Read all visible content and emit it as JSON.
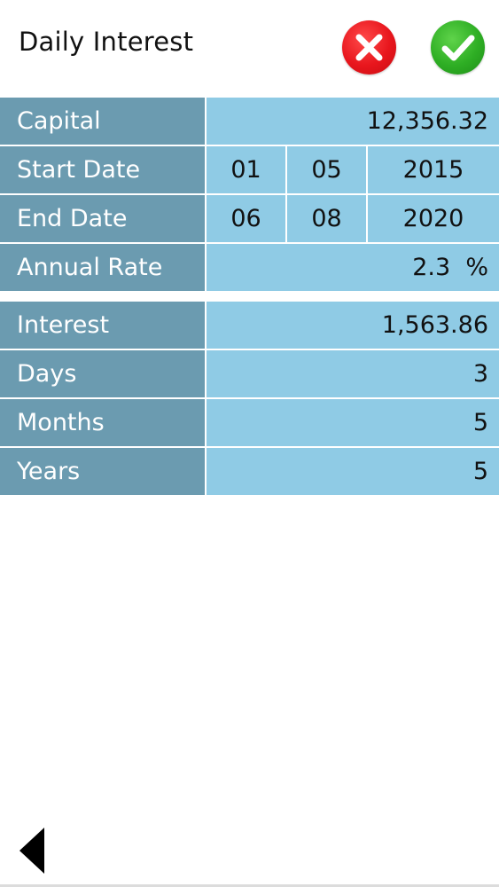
{
  "header": {
    "title": "Daily Interest"
  },
  "inputs": {
    "capital": {
      "label": "Capital",
      "value": "12,356.32"
    },
    "start_date": {
      "label": "Start Date",
      "day": "01",
      "month": "05",
      "year": "2015"
    },
    "end_date": {
      "label": "End Date",
      "day": "06",
      "month": "08",
      "year": "2020"
    },
    "annual_rate": {
      "label": "Annual Rate",
      "value": "2.3  %"
    }
  },
  "results": {
    "interest": {
      "label": "Interest",
      "value": "1,563.86"
    },
    "days": {
      "label": "Days",
      "value": "3"
    },
    "months": {
      "label": "Months",
      "value": "5"
    },
    "years": {
      "label": "Years",
      "value": "5"
    }
  },
  "icons": {
    "cancel": "close-icon",
    "confirm": "checkmark-icon",
    "back": "back-arrow-icon"
  },
  "colors": {
    "label_bg": "#6b9bb0",
    "value_bg": "#8fcbe5",
    "cancel": "#e8161d",
    "confirm": "#2eae24"
  }
}
